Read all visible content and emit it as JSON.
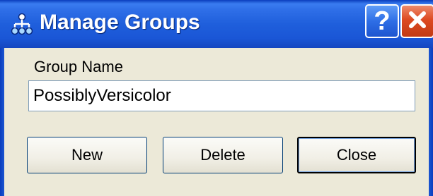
{
  "window": {
    "title": "Manage Groups",
    "icon": "group-hierarchy-icon",
    "help_label": "?",
    "help_icon": "help-icon",
    "close_icon": "close-x-icon"
  },
  "form": {
    "group_name_label": "Group Name",
    "group_name_value": "PossiblyVersicolor"
  },
  "buttons": {
    "new_label": "New",
    "delete_label": "Delete",
    "close_label": "Close"
  },
  "colors": {
    "titlebar": "#1f5fdc",
    "dialog_background": "#ece9d8",
    "close_button": "#dd4a22"
  }
}
